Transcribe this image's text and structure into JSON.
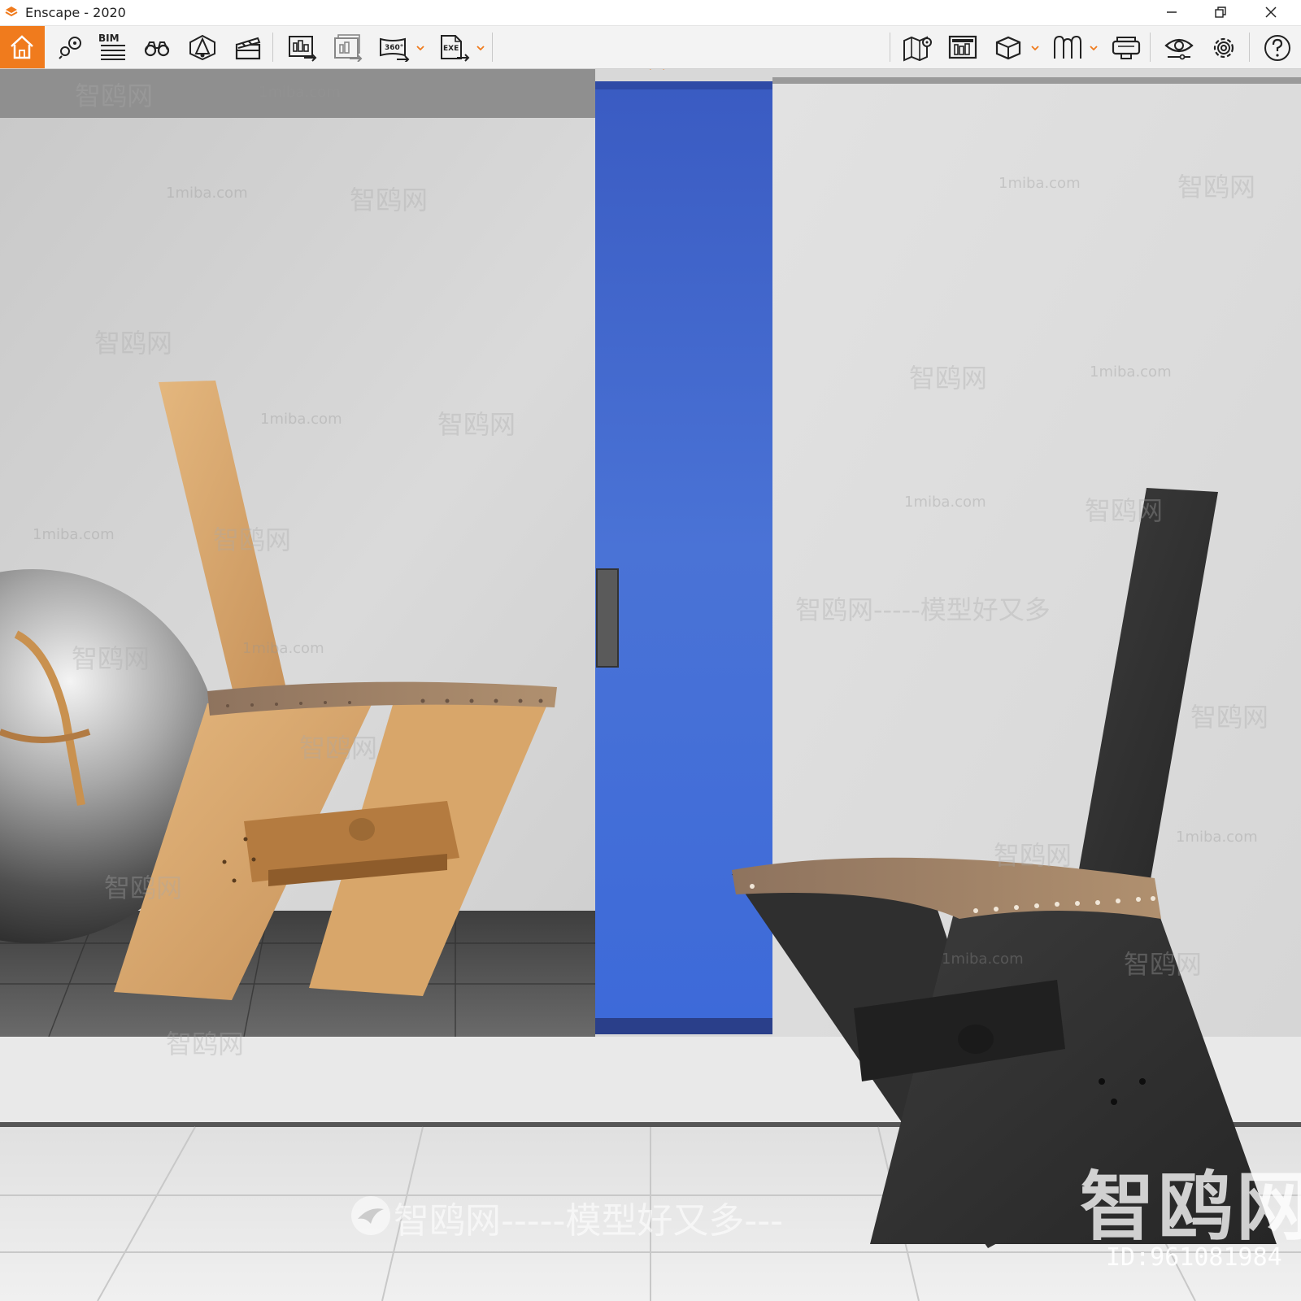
{
  "window": {
    "title": "Enscape - 2020",
    "minimize_icon": "minimize-icon",
    "restore_icon": "restore-icon",
    "close_icon": "close-icon"
  },
  "toolbar": {
    "bim_label": "BIM",
    "accent_color": "#f07b1d",
    "left_tools": [
      "home-icon",
      "views-icon",
      "bim-icon",
      "binocular-icon",
      "sun-icon",
      "video-icon"
    ],
    "export_tools": [
      "screenshot-export-icon",
      "batch-export-icon",
      "panorama-360-icon",
      "exe-export-icon"
    ],
    "right_tools": [
      "map-icon",
      "minimap-icon",
      "asset-library-icon",
      "material-icon",
      "vr-headset-icon",
      "visual-settings-icon",
      "settings-gear-icon",
      "help-icon"
    ]
  },
  "scene": {
    "description_colors": {
      "wall": "#d9d9d9",
      "door": "#3f67d6",
      "floor": "#e6e6e6",
      "dark_floor": "#4a4a4a",
      "wood": "#d6a66c",
      "black_wood": "#333333",
      "leather": "#a2836a"
    },
    "watermarks": {
      "site_small": "1miba.com",
      "site_cn": "智鸥网",
      "slogan": "智鸥网-----模型好又多",
      "big_logo": "智鸥网",
      "id_text": "ID:961081984",
      "bottom": "智鸥网-----模型好又多---"
    }
  }
}
